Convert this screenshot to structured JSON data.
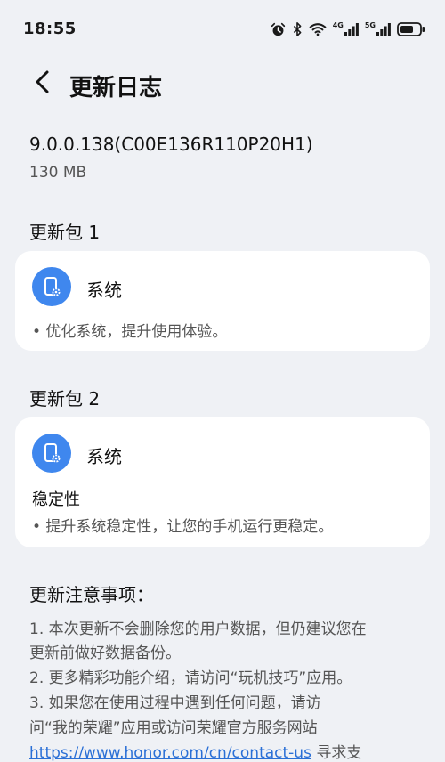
{
  "status_bar": {
    "time": "18:55",
    "icons": [
      "alarm-icon",
      "bluetooth-icon",
      "wifi-icon",
      "signal-4g-icon",
      "signal-5g-icon",
      "battery-icon"
    ],
    "net1": "4G",
    "net2": "5G"
  },
  "header": {
    "title": "更新日志"
  },
  "version": "9.0.0.138(C00E136R110P20H1)",
  "size": "130 MB",
  "packages": [
    {
      "title": "更新包 1",
      "heading": "系统",
      "items": [
        "• 优化系统，提升使用体验。"
      ]
    },
    {
      "title": "更新包 2",
      "heading": "系统",
      "subheading": "稳定性",
      "items": [
        "• 提升系统稳定性，让您的手机运行更稳定。"
      ]
    }
  ],
  "notes": {
    "title": "更新注意事项：",
    "lines": [
      "1. 本次更新不会删除您的用户数据，但仍建议您在",
      "更新前做好数据备份。",
      "2. 更多精彩功能介绍，请访问“玩机技巧”应用。",
      "3. 如果您在使用过程中遇到任何问题，请访",
      "问“我的荣耀”应用或访问荣耀官方服务网站"
    ],
    "link": "https://www.honor.com/cn/contact-us",
    "link_suffix": " 寻求支"
  },
  "colors": {
    "accent": "#3f87ee",
    "link": "#2a6fd6",
    "background": "#eff1f5"
  }
}
